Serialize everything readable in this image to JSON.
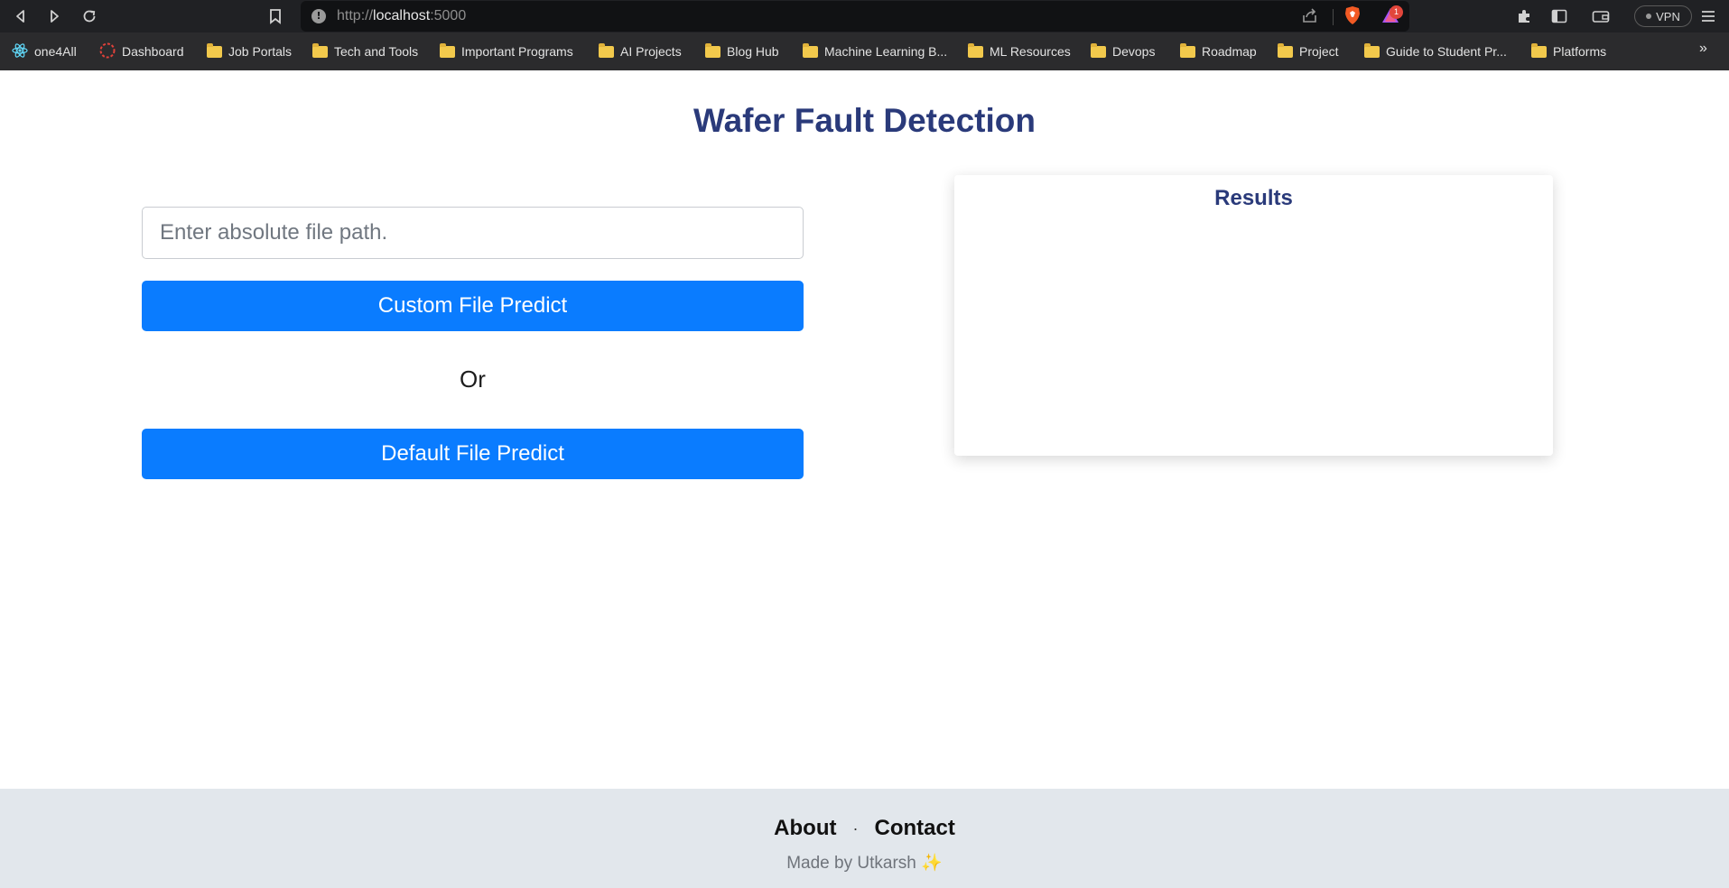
{
  "browser": {
    "url_scheme": "http://",
    "url_host": "localhost",
    "url_port": ":5000",
    "rewards_badge": "1",
    "vpn_label": "VPN",
    "bookmarks": [
      {
        "label": "one4All",
        "icon": "react-icon"
      },
      {
        "label": "Dashboard",
        "icon": "dashboard-icon"
      },
      {
        "label": "Job Portals",
        "icon": "folder-icon"
      },
      {
        "label": "Tech and Tools",
        "icon": "folder-icon"
      },
      {
        "label": "Important Programs",
        "icon": "folder-icon"
      },
      {
        "label": "AI Projects",
        "icon": "folder-icon"
      },
      {
        "label": "Blog Hub",
        "icon": "folder-icon"
      },
      {
        "label": "Machine Learning B...",
        "icon": "folder-icon"
      },
      {
        "label": "ML Resources",
        "icon": "folder-icon"
      },
      {
        "label": "Devops",
        "icon": "folder-icon"
      },
      {
        "label": "Roadmap",
        "icon": "folder-icon"
      },
      {
        "label": "Project",
        "icon": "folder-icon"
      },
      {
        "label": "Guide to Student Pr...",
        "icon": "folder-icon"
      },
      {
        "label": "Platforms",
        "icon": "folder-icon"
      }
    ],
    "more_bookmarks": "»"
  },
  "page": {
    "title": "Wafer Fault Detection",
    "file_input": {
      "placeholder": "Enter absolute file path.",
      "value": ""
    },
    "custom_button": "Custom File Predict",
    "or_text": "Or",
    "default_button": "Default File Predict",
    "results_title": "Results"
  },
  "footer": {
    "about": "About",
    "separator": "·",
    "contact": "Contact",
    "credit": "Made by Utkarsh ✨"
  },
  "colors": {
    "primary_button": "#0a7cff",
    "heading": "#2a3a7a",
    "footer_bg": "#e2e7ec"
  }
}
